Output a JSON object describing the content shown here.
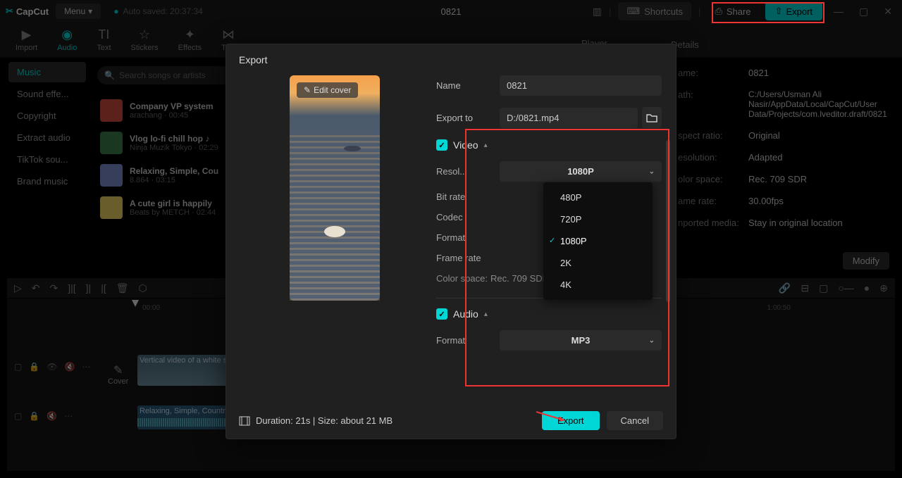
{
  "topbar": {
    "app_name": "CapCut",
    "menu_label": "Menu",
    "autosave": "Auto saved: 20:37:34",
    "project": "0821",
    "shortcuts": "Shortcuts",
    "share": "Share",
    "export": "Export"
  },
  "tabs": {
    "import": "Import",
    "audio": "Audio",
    "text": "Text",
    "stickers": "Stickers",
    "effects": "Effects",
    "transitions": "Trar"
  },
  "player_label": "Player",
  "details_label": "Details",
  "sidebar": {
    "items": [
      "Music",
      "Sound effe...",
      "Copyright",
      "Extract audio",
      "TikTok sou...",
      "Brand music"
    ]
  },
  "search_placeholder": "Search songs or artists",
  "music": [
    {
      "title": "Company VP system",
      "meta": "arachang · 00:45",
      "color": "#c94a3a"
    },
    {
      "title": "Vlog lo-fi chill hop ♪",
      "meta": "Ninja Muzik Tokyo · 02:29",
      "color": "#3a7a4a"
    },
    {
      "title": "Relaxing, Simple, Cou",
      "meta": "8.864 · 03:15",
      "color": "#7a8aca"
    },
    {
      "title": "A cute girl is happily",
      "meta": "Beats by METCH · 02:44",
      "color": "#e8d060"
    }
  ],
  "details": {
    "name_label": "ame:",
    "name_value": "0821",
    "path_label": "ath:",
    "path_value": "C:/Users/Usman Ali Nasir/AppData/Local/CapCut/User Data/Projects/com.lveditor.draft/0821",
    "aspect_label": "spect ratio:",
    "aspect_value": "Original",
    "resolution_label": "esolution:",
    "resolution_value": "Adapted",
    "colorspace_label": "olor space:",
    "colorspace_value": "Rec. 709 SDR",
    "framerate_label": "ame rate:",
    "framerate_value": "30.00fps",
    "media_label": "nported media:",
    "media_value": "Stay in original location",
    "modify": "Modify"
  },
  "timeline": {
    "t0": "00:00",
    "t1": "1:00:50",
    "video_clip": "Vertical video of a white s",
    "cover": "Cover",
    "audio_clip": "Relaxing, Simple, Country"
  },
  "modal": {
    "title": "Export",
    "edit_cover": "Edit cover",
    "name_label": "Name",
    "name_value": "0821",
    "exportto_label": "Export to",
    "exportto_value": "D:/0821.mp4",
    "video_label": "Video",
    "resolution_label": "Resol...",
    "resolution_value": "1080P",
    "bitrate_label": "Bit rate",
    "codec_label": "Codec",
    "format_label": "Format",
    "framerate_label": "Frame rate",
    "colorspace_label": "Color space:",
    "colorspace_value": "Rec. 709 SDR",
    "audio_label": "Audio",
    "audio_format_label": "Format",
    "audio_format_value": "MP3",
    "footer_info": "Duration: 21s | Size: about 21 MB",
    "export_btn": "Export",
    "cancel_btn": "Cancel",
    "resolution_options": [
      "480P",
      "720P",
      "1080P",
      "2K",
      "4K"
    ]
  }
}
